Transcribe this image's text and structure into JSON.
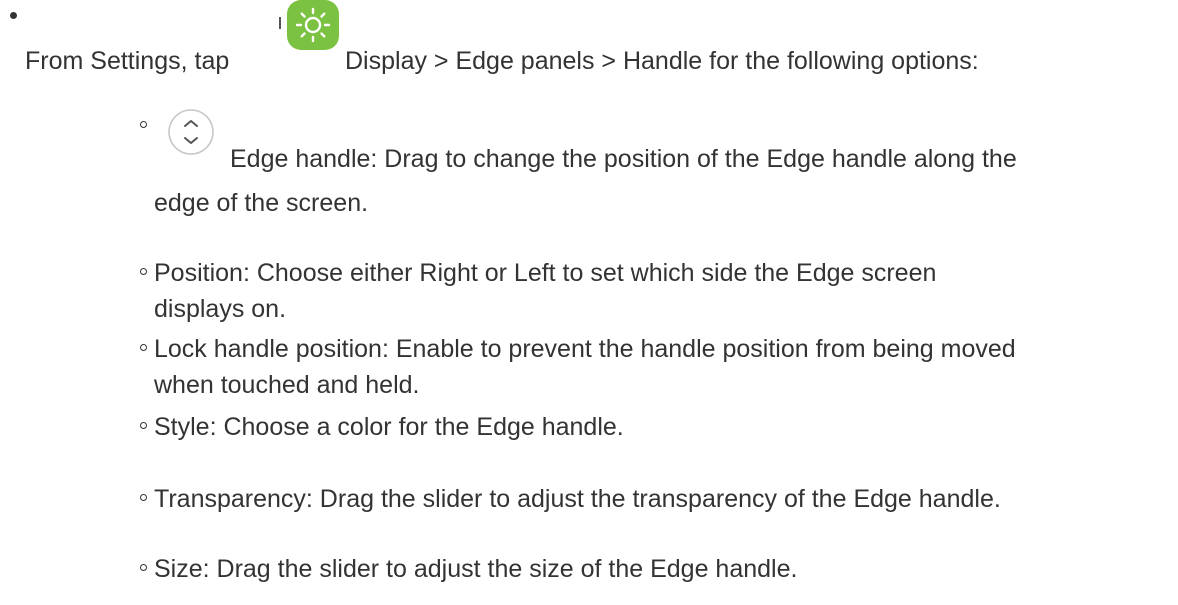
{
  "intro": {
    "lead_text": "From Settings, tap",
    "path_text": "Display > Edge panels > Handle for the following options:"
  },
  "icons": {
    "settings": "settings-gear-icon",
    "edge_handle": "edge-handle-icon"
  },
  "colors": {
    "settings_icon_green": "#7cc242",
    "text": "#333333"
  },
  "options": [
    {
      "line1": "Edge handle: Drag to change the position of the Edge handle along the",
      "line2": "edge of the screen."
    },
    {
      "line1": "Position: Choose either Right or Left to set which side the Edge screen",
      "line2": "displays on."
    },
    {
      "line1": "Lock handle position: Enable to prevent the handle position from being moved",
      "line2": "when touched and held."
    },
    {
      "line1": "Style: Choose a color for the Edge handle."
    },
    {
      "line1": "Transparency: Drag the slider to adjust the transparency of the Edge handle."
    },
    {
      "line1": "Size: Drag the slider to adjust the size of the Edge handle."
    }
  ]
}
